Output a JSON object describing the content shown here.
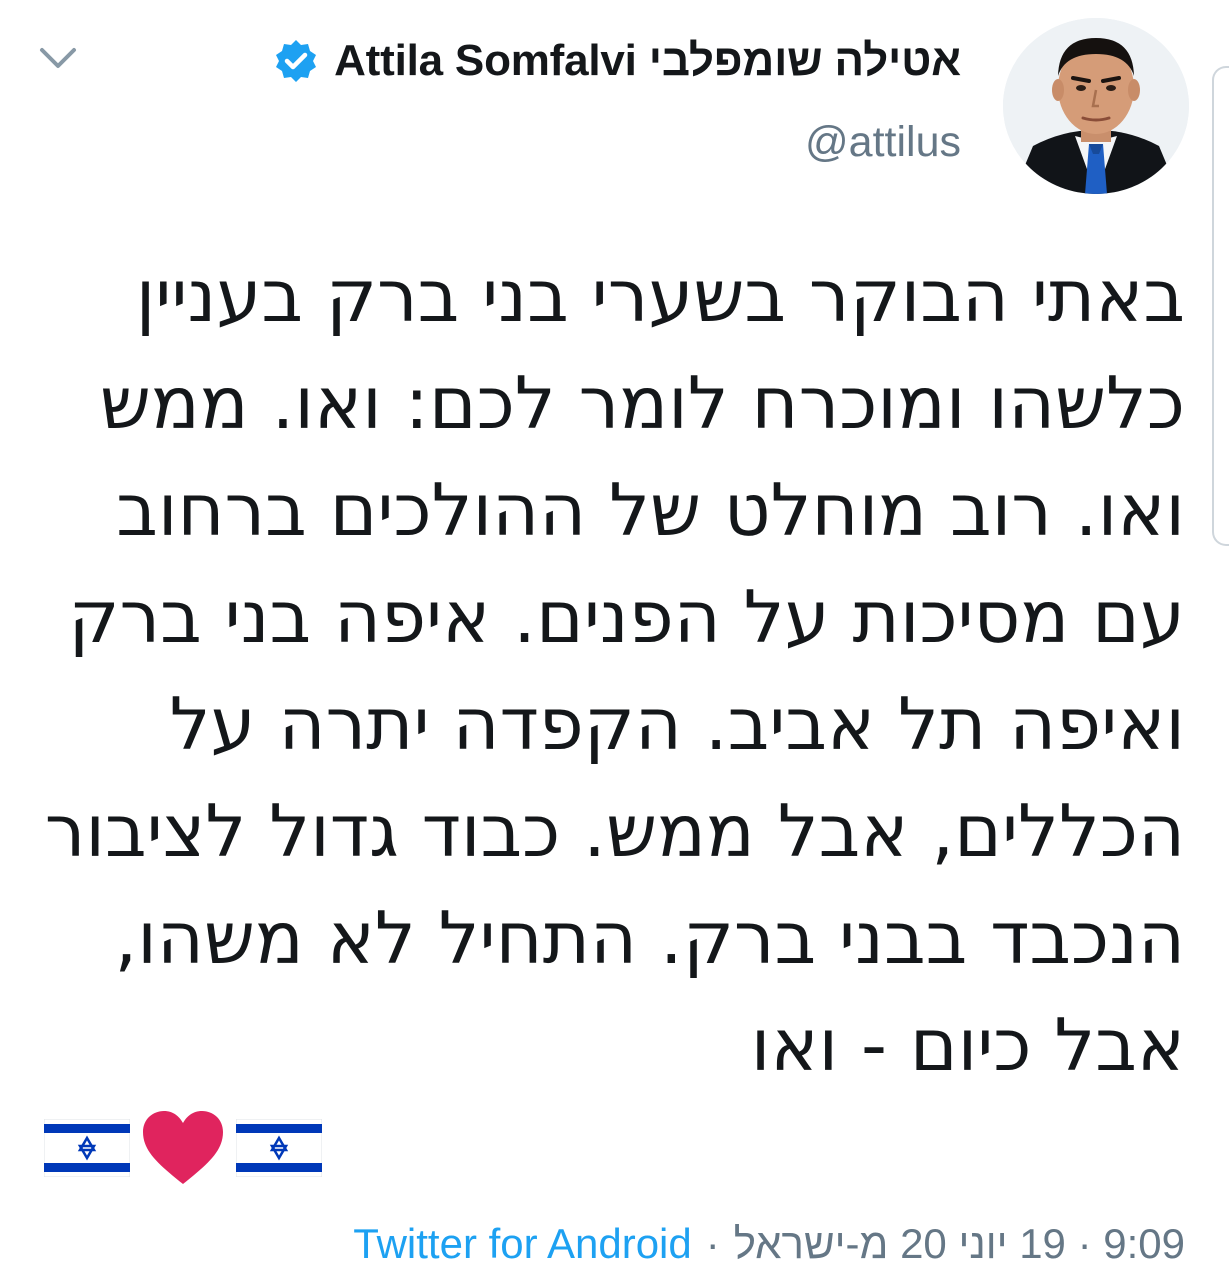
{
  "tweet": {
    "display_name": "אטילה שומפלבי Attila Somfalvi",
    "handle": "@attilus",
    "verified_icon": "verified-badge-icon",
    "menu_icon": "chevron-down-icon",
    "text_lines": [
      "באתי הבוקר בשערי בני ברק בעניין",
      "כלשהו ומוכרח לומר לכם: ואו. ממש",
      "ואו. רוב מוחלט של ההולכים ברחוב",
      "עם מסיכות על הפנים. איפה בני ברק",
      "ואיפה תל אביב. הקפדה יתרה על",
      "הכללים, אבל ממש. כבוד גדול לציבור",
      "הנכבד בבני ברק. התחיל לא משהו,",
      "אבל כיום - ואו"
    ],
    "emojis": [
      "israel-flag",
      "red-heart",
      "israel-flag"
    ],
    "meta": {
      "datetime": "9:09 · 19 יוני 20 מ-ישראל",
      "separator": "·",
      "source": "Twitter for Android"
    }
  },
  "colors": {
    "text": "#14171a",
    "secondary": "#657786",
    "link": "#1da1f2",
    "verified": "#1da1f2",
    "heart": "#e0245e",
    "flag_blue": "#0038b8"
  }
}
